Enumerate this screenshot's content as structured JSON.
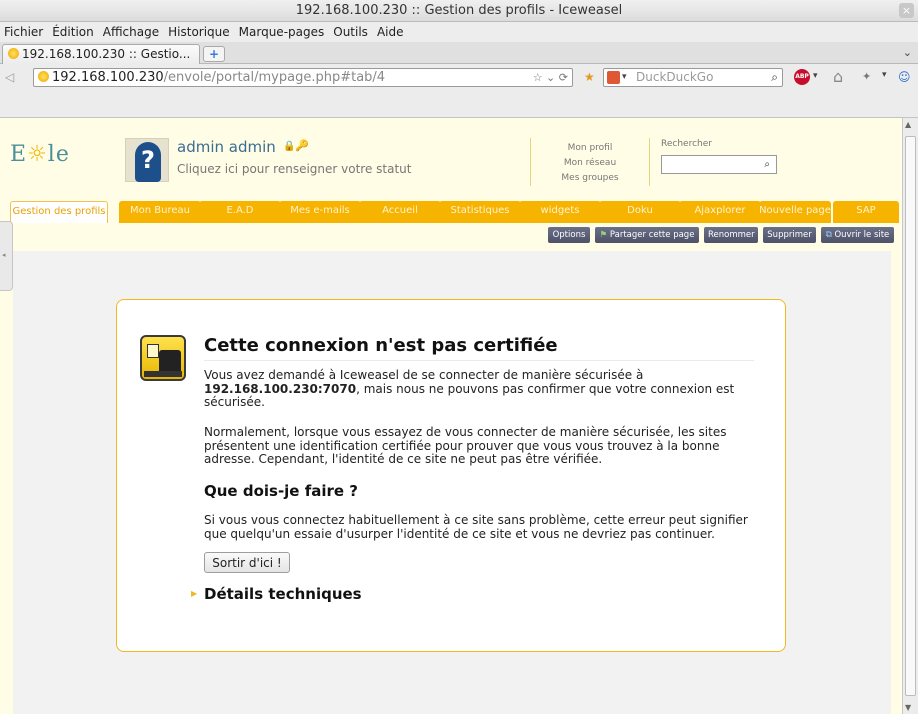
{
  "window": {
    "title": "192.168.100.230 :: Gestion des profils - Iceweasel",
    "close_glyph": "×"
  },
  "menu": [
    "Fichier",
    "Édition",
    "Affichage",
    "Historique",
    "Marque-pages",
    "Outils",
    "Aide"
  ],
  "tab": {
    "title": "192.168.100.230 :: Gestio..."
  },
  "address": {
    "host": "192.168.100.230",
    "path": "/envole/portal/mypage.php#tab/4"
  },
  "search_engine": {
    "placeholder": "DuckDuckGo"
  },
  "toolbar": {
    "abp_label": "ABP"
  },
  "portal": {
    "logo_text_a": "E",
    "logo_sun": "☼",
    "logo_text_b": "le",
    "avatar_glyph": "?",
    "user_name": "admin admin",
    "user_status": "Cliquez ici pour renseigner votre statut",
    "links": [
      "Mon profil",
      "Mon réseau",
      "Mes groupes"
    ],
    "search_label": "Rechercher",
    "tabs": [
      "Gestion des profils",
      "Mon Bureau",
      "E.A.D",
      "Mes e-mails",
      "Accueil",
      "Statistiques",
      "widgets",
      "Doku",
      "Ajaxplorer",
      "Nouvelle page",
      "SAP"
    ],
    "active_tab": 0,
    "buttons": [
      "Options",
      "Partager cette page",
      "Renommer",
      "Supprimer",
      "Ouvrir le site"
    ]
  },
  "error": {
    "title": "Cette connexion n'est pas certifiée",
    "p1_pre": "Vous avez demandé à Iceweasel de se connecter de manière sécurisée à",
    "p1_host": "192.168.100.230:7070",
    "p1_post": ", mais nous ne pouvons pas confirmer que votre connexion est sécurisée.",
    "p2": "Normalement, lorsque vous essayez de vous connecter de manière sécurisée, les sites présentent une identification certifiée pour prouver que vous vous trouvez à la bonne adresse. Cependant, l'identité de ce site ne peut pas être vérifiée.",
    "what_title": "Que dois-je faire ?",
    "p3": "Si vous vous connectez habituellement à ce site sans problème, cette erreur peut signifier que quelqu'un essaie d'usurper l'identité de ce site et vous ne devriez pas continuer.",
    "exit_label": "Sortir d'ici !",
    "details_title": "Détails techniques"
  }
}
